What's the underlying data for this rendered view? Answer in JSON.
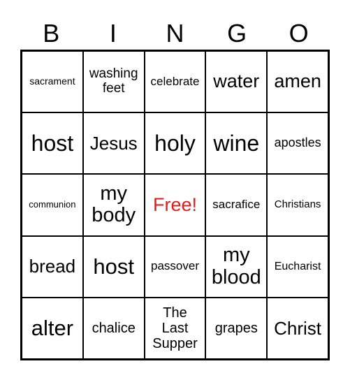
{
  "header": [
    "B",
    "I",
    "N",
    "G",
    "O"
  ],
  "free_color": "#e31b1b",
  "rows": [
    [
      "sacrament",
      "washing feet",
      "celebrate",
      "water",
      "amen"
    ],
    [
      "host",
      "Jesus",
      "holy",
      "wine",
      "apostles"
    ],
    [
      "communion",
      "my body",
      "Free!",
      "sacrafice",
      "Christians"
    ],
    [
      "bread",
      "host",
      "passover",
      "my blood",
      "Eucharist"
    ],
    [
      "alter",
      "chalice",
      "The Last Supper",
      "grapes",
      "Christ"
    ]
  ]
}
